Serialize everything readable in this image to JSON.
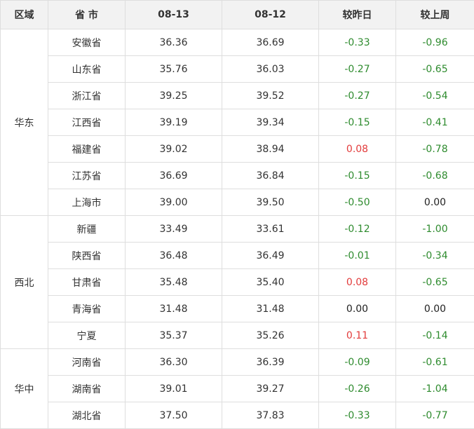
{
  "headers": {
    "region": "区域",
    "province": "省 市",
    "date1": "08-13",
    "date2": "08-12",
    "vs_yesterday": "较昨日",
    "vs_last_week": "较上周"
  },
  "colors": {
    "negative": "#2e8b2e",
    "positive": "#e23b3b",
    "neutral": "#222222"
  },
  "regions": [
    {
      "name": "华东",
      "rows": [
        {
          "province": "安徽省",
          "d1": "36.36",
          "d2": "36.69",
          "vs_yesterday": "-0.33",
          "vs_last_week": "-0.96"
        },
        {
          "province": "山东省",
          "d1": "35.76",
          "d2": "36.03",
          "vs_yesterday": "-0.27",
          "vs_last_week": "-0.65"
        },
        {
          "province": "浙江省",
          "d1": "39.25",
          "d2": "39.52",
          "vs_yesterday": "-0.27",
          "vs_last_week": "-0.54"
        },
        {
          "province": "江西省",
          "d1": "39.19",
          "d2": "39.34",
          "vs_yesterday": "-0.15",
          "vs_last_week": "-0.41"
        },
        {
          "province": "福建省",
          "d1": "39.02",
          "d2": "38.94",
          "vs_yesterday": "0.08",
          "vs_last_week": "-0.78"
        },
        {
          "province": "江苏省",
          "d1": "36.69",
          "d2": "36.84",
          "vs_yesterday": "-0.15",
          "vs_last_week": "-0.68"
        },
        {
          "province": "上海市",
          "d1": "39.00",
          "d2": "39.50",
          "vs_yesterday": "-0.50",
          "vs_last_week": "0.00"
        }
      ]
    },
    {
      "name": "西北",
      "rows": [
        {
          "province": "新疆",
          "d1": "33.49",
          "d2": "33.61",
          "vs_yesterday": "-0.12",
          "vs_last_week": "-1.00"
        },
        {
          "province": "陕西省",
          "d1": "36.48",
          "d2": "36.49",
          "vs_yesterday": "-0.01",
          "vs_last_week": "-0.34"
        },
        {
          "province": "甘肃省",
          "d1": "35.48",
          "d2": "35.40",
          "vs_yesterday": "0.08",
          "vs_last_week": "-0.65"
        },
        {
          "province": "青海省",
          "d1": "31.48",
          "d2": "31.48",
          "vs_yesterday": "0.00",
          "vs_last_week": "0.00"
        },
        {
          "province": "宁夏",
          "d1": "35.37",
          "d2": "35.26",
          "vs_yesterday": "0.11",
          "vs_last_week": "-0.14"
        }
      ]
    },
    {
      "name": "华中",
      "rows": [
        {
          "province": "河南省",
          "d1": "36.30",
          "d2": "36.39",
          "vs_yesterday": "-0.09",
          "vs_last_week": "-0.61"
        },
        {
          "province": "湖南省",
          "d1": "39.01",
          "d2": "39.27",
          "vs_yesterday": "-0.26",
          "vs_last_week": "-1.04"
        },
        {
          "province": "湖北省",
          "d1": "37.50",
          "d2": "37.83",
          "vs_yesterday": "-0.33",
          "vs_last_week": "-0.77"
        }
      ]
    }
  ]
}
